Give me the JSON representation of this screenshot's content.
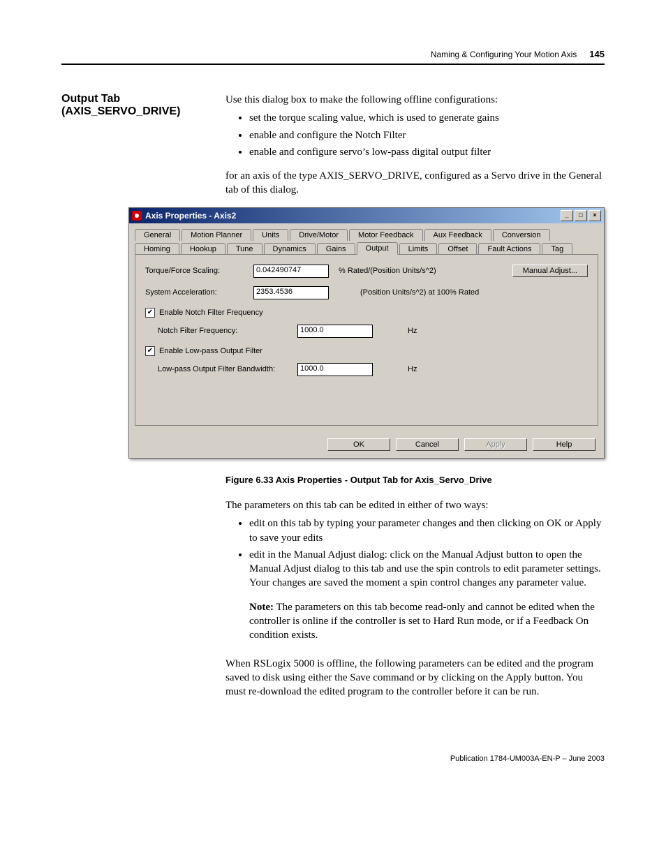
{
  "header": {
    "text": "Naming & Configuring Your Motion Axis",
    "page": "145"
  },
  "section_label": "Output Tab (AXIS_SERVO_DRIVE)",
  "intro": "Use this dialog box to make the following offline configurations:",
  "intro_bullets": [
    "set the torque scaling value, which is used to generate gains",
    "enable and configure the Notch Filter",
    "enable and configure servo’s low-pass digital output filter"
  ],
  "intro2": "for an axis of the type AXIS_SERVO_DRIVE, configured as a Servo drive in the General tab of this dialog.",
  "dialog": {
    "title": "Axis Properties - Axis2",
    "tabs_row1": [
      "General",
      "Motion Planner",
      "Units",
      "Drive/Motor",
      "Motor Feedback",
      "Aux Feedback",
      "Conversion"
    ],
    "tabs_row2": [
      "Homing",
      "Hookup",
      "Tune",
      "Dynamics",
      "Gains",
      "Output",
      "Limits",
      "Offset",
      "Fault Actions",
      "Tag"
    ],
    "active_tab": "Output",
    "torque_label": "Torque/Force Scaling:",
    "torque_value": "0.042490747",
    "torque_unit": "% Rated/(Position Units/s^2)",
    "manual_adjust": "Manual Adjust...",
    "accel_label": "System Acceleration:",
    "accel_value": "2353.4536",
    "accel_unit": "(Position Units/s^2) at 100% Rated",
    "notch_chk": "Enable Notch Filter Frequency",
    "notch_label": "Notch Filter Frequency:",
    "notch_value": "1000.0",
    "notch_unit": "Hz",
    "lp_chk": "Enable Low-pass Output Filter",
    "lp_label": "Low-pass Output Filter Bandwidth:",
    "lp_value": "1000.0",
    "lp_unit": "Hz",
    "buttons": {
      "ok": "OK",
      "cancel": "Cancel",
      "apply": "Apply",
      "help": "Help"
    }
  },
  "fig_caption": "Figure 6.33 Axis Properties - Output Tab for Axis_Servo_Drive",
  "after1": "The parameters on this tab can be edited in either of two ways:",
  "after_bullets": [
    "edit on this tab by typing your parameter changes and then clicking on OK or Apply to save your edits",
    "edit in the Manual Adjust dialog: click on the Manual Adjust button to open the Manual Adjust dialog to this tab and use the spin controls to edit parameter settings. Your changes are saved the moment a spin control changes any parameter value."
  ],
  "note_label": "Note:",
  "note_text": " The parameters on this tab become read-only and cannot be edited when the controller is online if the controller is set to Hard Run mode, or if a Feedback On condition exists.",
  "after2": "When RSLogix 5000 is offline, the following parameters can be edited and the program saved to disk using either the Save command or by clicking on the Apply button. You must re-download the edited program to the controller before it can be run.",
  "footer": "Publication 1784-UM003A-EN-P – June 2003"
}
